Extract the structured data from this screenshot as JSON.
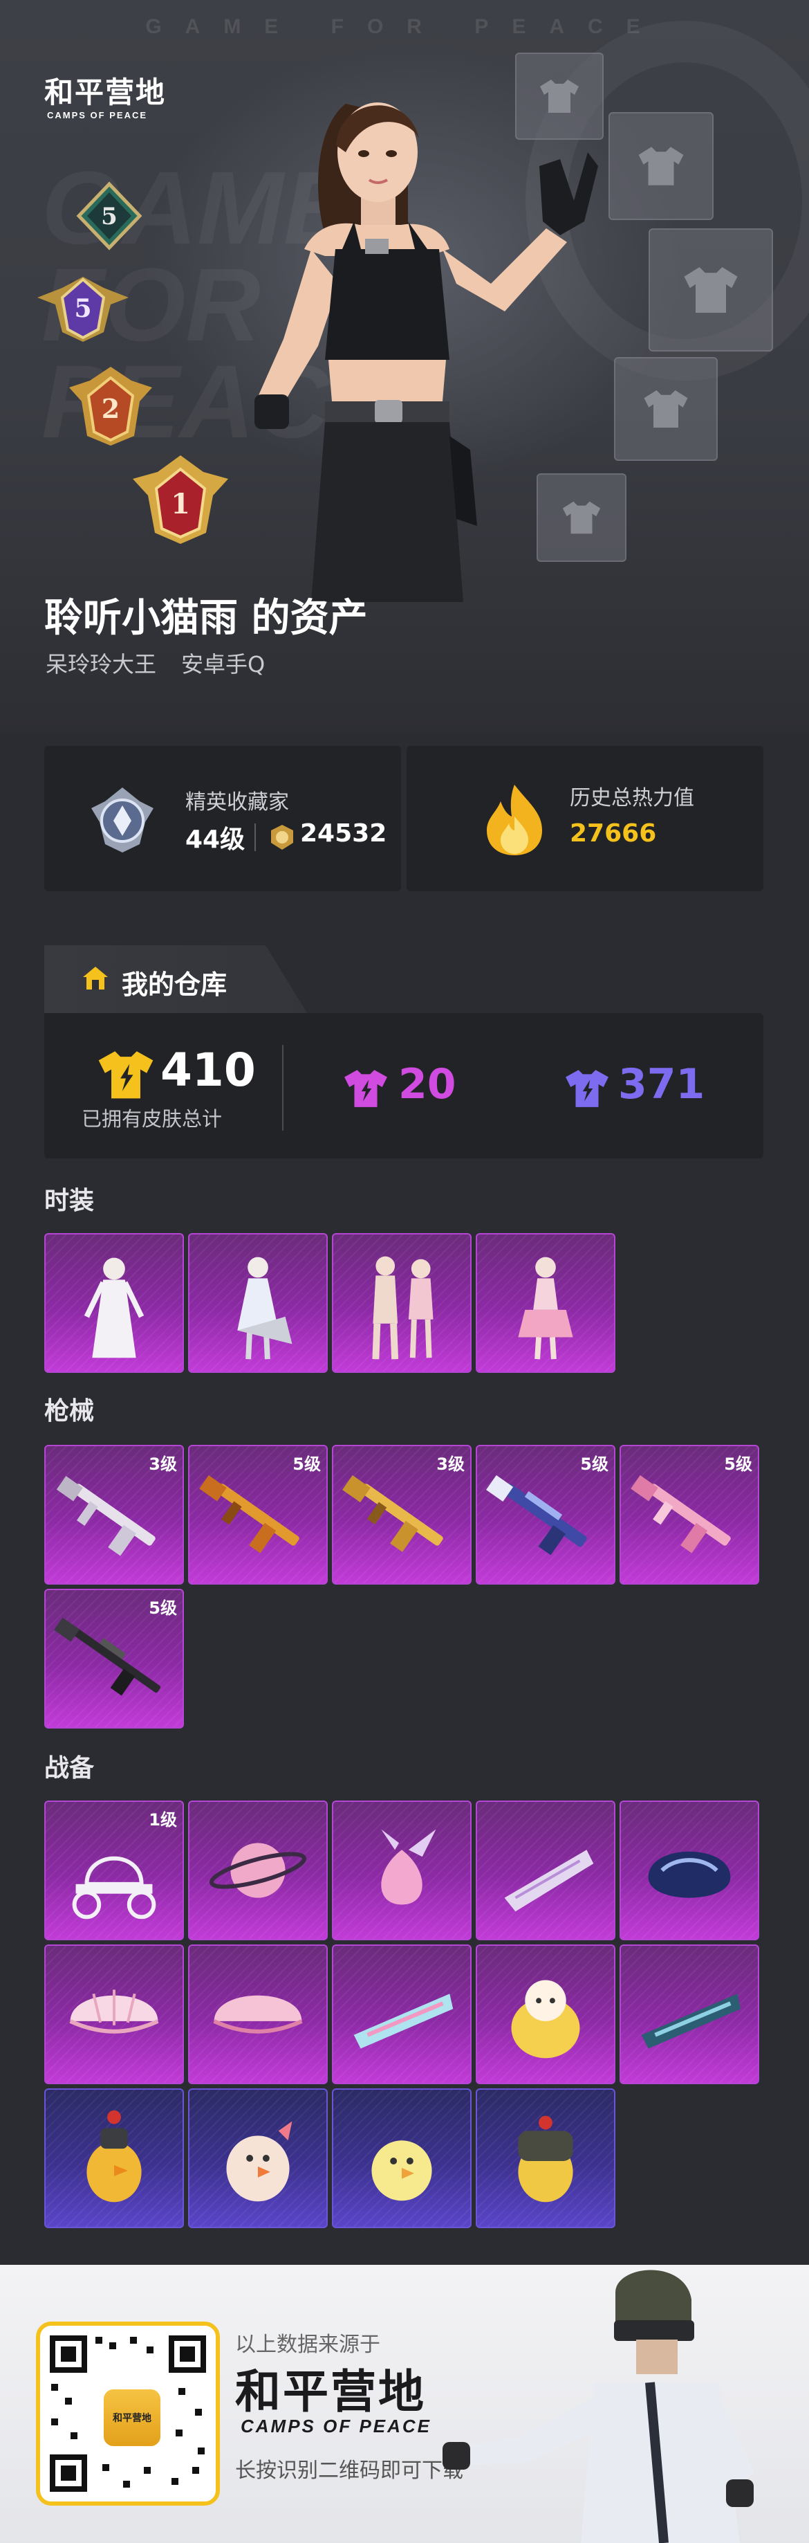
{
  "hero": {
    "tagline": "GAME FOR PEACE",
    "watermark": "GAME FOR PEACE",
    "logo_main": "和平营地",
    "logo_sub": "CAMPS OF PEACE",
    "ranks": [
      "5",
      "5",
      "2",
      "1"
    ],
    "player_title": "聆听小猫雨 的资产",
    "player_sub_1": "呆玲玲大王",
    "player_sub_2": "安卓手Q"
  },
  "stats": {
    "collector_label": "精英收藏家",
    "level": "44级",
    "points": "24532",
    "heat_label": "历史总热力值",
    "heat_value": "27666"
  },
  "warehouse": {
    "title": "我的仓库",
    "total": "410",
    "total_label": "已拥有皮肤总计",
    "purple_count": "20",
    "blue_count": "371"
  },
  "sections": {
    "fashion": "时装",
    "guns": "枪械",
    "gear": "战备"
  },
  "gun_levels": [
    "3级",
    "5级",
    "3级",
    "5级",
    "5级",
    "5级"
  ],
  "gear_levels": [
    "1级"
  ],
  "footer": {
    "source": "以上数据来源于",
    "logo_main": "和平营地",
    "logo_sub": "CAMPS OF PEACE",
    "hint": "长按识别二维码即可下载",
    "app_icon": "和平营地"
  },
  "colors": {
    "gold": "#f5c11c",
    "purple_accent": "#d04be0",
    "blue_accent": "#7e6cf0"
  },
  "icons": [
    "home-icon",
    "shirt-icon",
    "flame-icon",
    "badge-icon",
    "coin-icon"
  ]
}
